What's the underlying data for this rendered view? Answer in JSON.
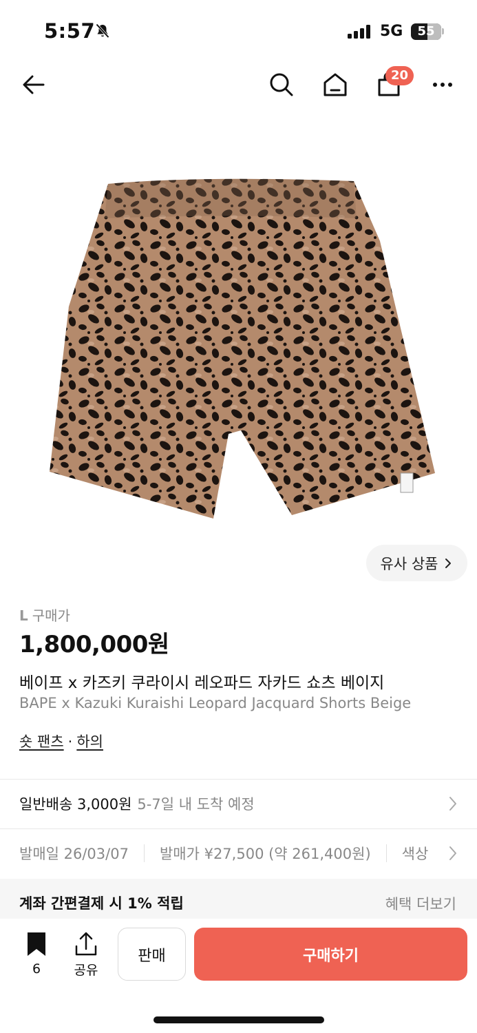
{
  "status_bar": {
    "time": "5:57",
    "network": "5G",
    "battery_level": "55",
    "battery_fraction": 0.55,
    "icons": [
      "bell-slash-icon",
      "signal-bars-icon",
      "battery-icon"
    ]
  },
  "nav": {
    "icons": [
      "back-arrow-icon",
      "search-icon",
      "home-icon",
      "shopping-bag-icon",
      "more-dots-icon"
    ],
    "cart_count": "20"
  },
  "product": {
    "image_description_icon": "leopard-shorts-image",
    "similar_label": "유사 상품",
    "size": "L",
    "price_label": "구매가",
    "price": "1,800,000원",
    "title_ko": "베이프 x 카즈키 쿠라이시 레오파드 자카드 쇼츠 베이지",
    "title_en": "BAPE x Kazuki Kuraishi Leopard Jacquard Shorts Beige",
    "category_1": "숏 팬츠",
    "category_sep": "·",
    "category_2": "하의"
  },
  "shipping": {
    "label": "일반배송 3,000원",
    "eta": "5-7일 내 도착 예정"
  },
  "release_info": {
    "release_date": "발매일 26/03/07",
    "release_price": "발매가 ¥27,500 (약 261,400원)",
    "color": "색상"
  },
  "benefit": {
    "text": "계좌 간편결제 시 1% 적립",
    "more": "혜택 더보기"
  },
  "bottom_bar": {
    "bookmark_count": "6",
    "share_label": "공유",
    "sell_label": "판매",
    "buy_label": "구매하기"
  },
  "colors": {
    "accent": "#ef6253",
    "muted_text": "#888888",
    "light_bg": "#f6f6f6"
  }
}
